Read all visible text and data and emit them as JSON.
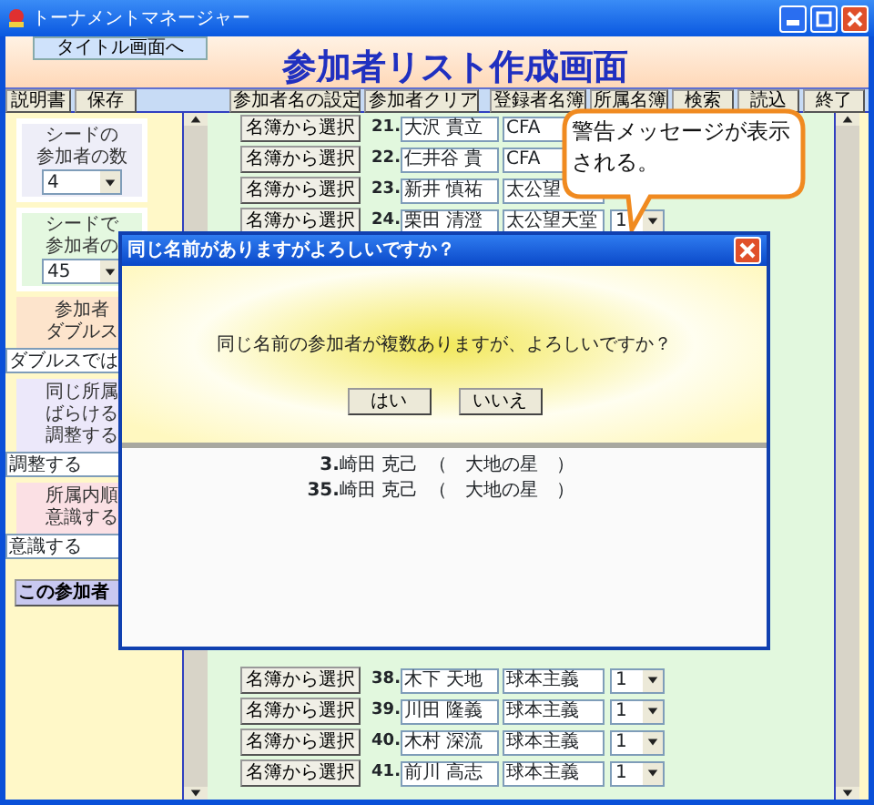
{
  "window": {
    "title": "トーナメントマネージャー"
  },
  "header": {
    "back_button": "タイトル画面へ",
    "heading": "参加者リスト作成画面"
  },
  "toolbar": {
    "left": [
      "説明書",
      "保存"
    ],
    "middle": [
      "参加者名の設定",
      "参加者クリア"
    ],
    "right": [
      "登録者名簿",
      "所属名簿",
      "検索",
      "読込",
      "終了"
    ]
  },
  "settings": [
    {
      "kind": "framed",
      "color": "#eeeef8",
      "label": [
        "シードの",
        "参加者の数"
      ],
      "select": "4"
    },
    {
      "kind": "framed",
      "color": "#e4f8e0",
      "label": [
        "シードで",
        "参加者の"
      ],
      "select": "45"
    },
    {
      "kind": "bar",
      "color": "#fde4cc",
      "label": [
        "参加者",
        "ダブルス"
      ],
      "select": "ダブルスでは"
    },
    {
      "kind": "bar",
      "color": "#ece8fa",
      "label": [
        "同じ所属",
        "ばらける",
        "調整する"
      ],
      "select": "調整する"
    },
    {
      "kind": "bar",
      "color": "#fbe0e4",
      "label": [
        "所属内順",
        "意識する"
      ],
      "select": "意識する"
    }
  ],
  "confirm_button": "この参加者",
  "rows_top": [
    {
      "pick": "名簿から選択",
      "number": "21.",
      "name": "大沢 貴立",
      "club": "CFA"
    },
    {
      "pick": "名簿から選択",
      "number": "22.",
      "name": "仁井谷 貴",
      "club": "CFA"
    },
    {
      "pick": "名簿から選択",
      "number": "23.",
      "name": "新井 慎祐",
      "club": "太公望"
    },
    {
      "pick": "名簿から選択",
      "number": "24.",
      "name": "栗田 清澄",
      "club": "太公望天堂",
      "select": "1"
    }
  ],
  "rows_bottom": [
    {
      "pick": "名簿から選択",
      "number": "38.",
      "name": "木下 天地",
      "club": "球本主義",
      "select": "1"
    },
    {
      "pick": "名簿から選択",
      "number": "39.",
      "name": "川田 隆義",
      "club": "球本主義",
      "select": "1"
    },
    {
      "pick": "名簿から選択",
      "number": "40.",
      "name": "木村 深流",
      "club": "球本主義",
      "select": "1"
    },
    {
      "pick": "名簿から選択",
      "number": "41.",
      "name": "前川 高志",
      "club": "球本主義",
      "select": "1"
    }
  ],
  "dialog": {
    "title": "同じ名前がありますがよろしいですか？",
    "message": "同じ名前の参加者が複数ありますが、よろしいですか？",
    "buttons": [
      "はい",
      "いいえ"
    ],
    "duplicates": [
      {
        "number": "3.",
        "name": "崎田 克己",
        "club": "（　大地の星　）"
      },
      {
        "number": "35.",
        "name": "崎田 克己",
        "club": "（　大地の星　）"
      }
    ]
  },
  "callout": {
    "text": "警告メッセージが表示される。"
  }
}
